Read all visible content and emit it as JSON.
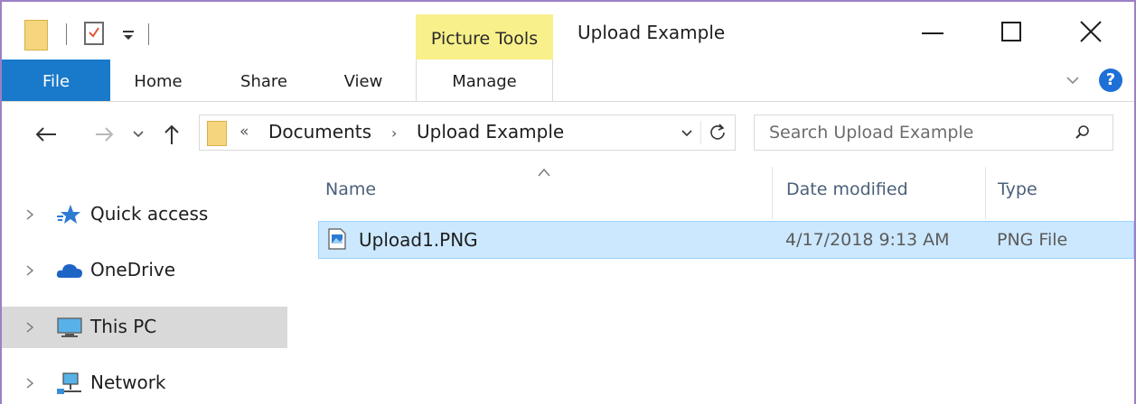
{
  "window": {
    "title": "Upload Example",
    "contextual_tab_group": "Picture Tools"
  },
  "ribbon": {
    "tabs": [
      {
        "label": "File",
        "active": true
      },
      {
        "label": "Home"
      },
      {
        "label": "Share"
      },
      {
        "label": "View"
      },
      {
        "label": "Manage"
      }
    ]
  },
  "address": {
    "overflow": "«",
    "breadcrumbs": [
      "Documents",
      "Upload Example"
    ],
    "separator": "›"
  },
  "search": {
    "placeholder": "Search Upload Example"
  },
  "nav_pane": {
    "items": [
      {
        "label": "Quick access",
        "icon": "star-icon"
      },
      {
        "label": "OneDrive",
        "icon": "cloud-icon"
      },
      {
        "label": "This PC",
        "icon": "monitor-icon",
        "selected": true
      },
      {
        "label": "Network",
        "icon": "network-icon"
      }
    ]
  },
  "file_list": {
    "columns": [
      "Name",
      "Date modified",
      "Type"
    ],
    "rows": [
      {
        "name": "Upload1.PNG",
        "date_modified": "4/17/2018 9:13 AM",
        "type": "PNG File",
        "selected": true
      }
    ]
  },
  "colors": {
    "file_tab": "#1979ca",
    "picture_tools": "#f8f08a",
    "selection": "#cce8ff",
    "window_border": "#9d7fc7"
  }
}
